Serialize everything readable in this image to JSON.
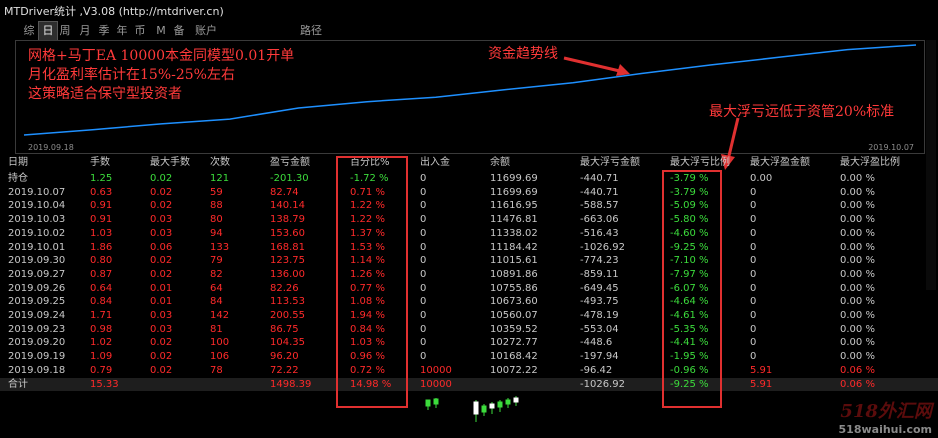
{
  "window": {
    "title": "MTDriver统计 ,V3.08 (http://mtdriver.cn)"
  },
  "tabs": [
    {
      "label": "综",
      "active": false
    },
    {
      "label": "日",
      "active": true
    },
    {
      "label": "周",
      "active": false
    },
    {
      "label": "月",
      "active": false
    },
    {
      "label": "季",
      "active": false
    },
    {
      "label": "年",
      "active": false
    },
    {
      "label": "币",
      "active": false
    },
    {
      "label": "M",
      "active": false
    },
    {
      "label": "备",
      "active": false
    },
    {
      "label": "账户",
      "active": false
    },
    {
      "label": "路径",
      "active": false
    }
  ],
  "chart": {
    "start_date": "2019.09.18",
    "end_date": "2019.10.07",
    "annotation_lines": [
      "网格+马丁EA 10000本金同模型0.01开单",
      "月化盈利率估计在15%-25%左右",
      "这策略适合保守型投资者"
    ],
    "trend_label": "资金趋势线",
    "drawdown_label": "最大浮亏远低于资管20%标准"
  },
  "chart_data": {
    "type": "line",
    "title": "",
    "xlabel": "",
    "ylabel": "",
    "x": [
      "2019.09.18",
      "2019.09.19",
      "2019.09.20",
      "2019.09.23",
      "2019.09.24",
      "2019.09.25",
      "2019.09.26",
      "2019.09.27",
      "2019.09.30",
      "2019.10.01",
      "2019.10.02",
      "2019.10.03",
      "2019.10.04",
      "2019.10.07"
    ],
    "series": [
      {
        "values": [
          10072.22,
          10168.42,
          10272.77,
          10359.52,
          10560.07,
          10673.6,
          10755.86,
          10891.86,
          11015.61,
          11184.42,
          11338.02,
          11476.81,
          11616.95,
          11699.69
        ]
      }
    ],
    "color": "#1e90ff"
  },
  "table": {
    "headers": [
      "日期",
      "手数",
      "最大手数",
      "次数",
      "盈亏金额",
      "百分比%",
      "出入金",
      "余额",
      "最大浮亏金额",
      "最大浮亏比例",
      "最大浮盈金额",
      "最大浮盈比例"
    ],
    "rows": [
      {
        "c": [
          "持仓",
          "1.25",
          "0.02",
          "121",
          "-201.30",
          "-1.72 %",
          "0",
          "11699.69",
          "-440.71",
          "-3.79 %",
          "0.00",
          "0.00 %"
        ],
        "type": "holding"
      },
      {
        "c": [
          "2019.10.07",
          "0.63",
          "0.02",
          "59",
          "82.74",
          "0.71 %",
          "0",
          "11699.69",
          "-440.71",
          "-3.79 %",
          "0",
          "0.00 %"
        ],
        "type": "day"
      },
      {
        "c": [
          "2019.10.04",
          "0.91",
          "0.02",
          "88",
          "140.14",
          "1.22 %",
          "0",
          "11616.95",
          "-588.57",
          "-5.09 %",
          "0",
          "0.00 %"
        ],
        "type": "day"
      },
      {
        "c": [
          "2019.10.03",
          "0.91",
          "0.03",
          "80",
          "138.79",
          "1.22 %",
          "0",
          "11476.81",
          "-663.06",
          "-5.80 %",
          "0",
          "0.00 %"
        ],
        "type": "day"
      },
      {
        "c": [
          "2019.10.02",
          "1.03",
          "0.03",
          "94",
          "153.60",
          "1.37 %",
          "0",
          "11338.02",
          "-516.43",
          "-4.60 %",
          "0",
          "0.00 %"
        ],
        "type": "day"
      },
      {
        "c": [
          "2019.10.01",
          "1.86",
          "0.06",
          "133",
          "168.81",
          "1.53 %",
          "0",
          "11184.42",
          "-1026.92",
          "-9.25 %",
          "0",
          "0.00 %"
        ],
        "type": "day"
      },
      {
        "c": [
          "2019.09.30",
          "0.80",
          "0.02",
          "79",
          "123.75",
          "1.14 %",
          "0",
          "11015.61",
          "-774.23",
          "-7.10 %",
          "0",
          "0.00 %"
        ],
        "type": "day"
      },
      {
        "c": [
          "2019.09.27",
          "0.87",
          "0.02",
          "82",
          "136.00",
          "1.26 %",
          "0",
          "10891.86",
          "-859.11",
          "-7.97 %",
          "0",
          "0.00 %"
        ],
        "type": "day"
      },
      {
        "c": [
          "2019.09.26",
          "0.64",
          "0.01",
          "64",
          "82.26",
          "0.77 %",
          "0",
          "10755.86",
          "-649.45",
          "-6.07 %",
          "0",
          "0.00 %"
        ],
        "type": "day"
      },
      {
        "c": [
          "2019.09.25",
          "0.84",
          "0.01",
          "84",
          "113.53",
          "1.08 %",
          "0",
          "10673.60",
          "-493.75",
          "-4.64 %",
          "0",
          "0.00 %"
        ],
        "type": "day"
      },
      {
        "c": [
          "2019.09.24",
          "1.71",
          "0.03",
          "142",
          "200.55",
          "1.94 %",
          "0",
          "10560.07",
          "-478.19",
          "-4.61 %",
          "0",
          "0.00 %"
        ],
        "type": "day"
      },
      {
        "c": [
          "2019.09.23",
          "0.98",
          "0.03",
          "81",
          "86.75",
          "0.84 %",
          "0",
          "10359.52",
          "-553.04",
          "-5.35 %",
          "0",
          "0.00 %"
        ],
        "type": "day"
      },
      {
        "c": [
          "2019.09.20",
          "1.02",
          "0.02",
          "100",
          "104.35",
          "1.03 %",
          "0",
          "10272.77",
          "-448.6",
          "-4.41 %",
          "0",
          "0.00 %"
        ],
        "type": "day"
      },
      {
        "c": [
          "2019.09.19",
          "1.09",
          "0.02",
          "106",
          "96.20",
          "0.96 %",
          "0",
          "10168.42",
          "-197.94",
          "-1.95 %",
          "0",
          "0.00 %"
        ],
        "type": "day"
      },
      {
        "c": [
          "2019.09.18",
          "0.79",
          "0.02",
          "78",
          "72.22",
          "0.72 %",
          "10000",
          "10072.22",
          "-96.42",
          "-0.96 %",
          "5.91",
          "0.06 %"
        ],
        "type": "day"
      },
      {
        "c": [
          "合计",
          "15.33",
          "",
          "",
          "1498.39",
          "14.98 %",
          "10000",
          "",
          "-1026.92",
          "-9.25 %",
          "5.91",
          "0.06 %"
        ],
        "type": "total"
      }
    ]
  },
  "colors": {
    "red": "#ff2a2a",
    "green": "#3cdc3c",
    "grey": "#c8c8c8",
    "line": "#1e90ff",
    "highlight": "#e03030"
  },
  "watermark": {
    "line1": "518外汇网",
    "line2": "518waihui.com"
  }
}
